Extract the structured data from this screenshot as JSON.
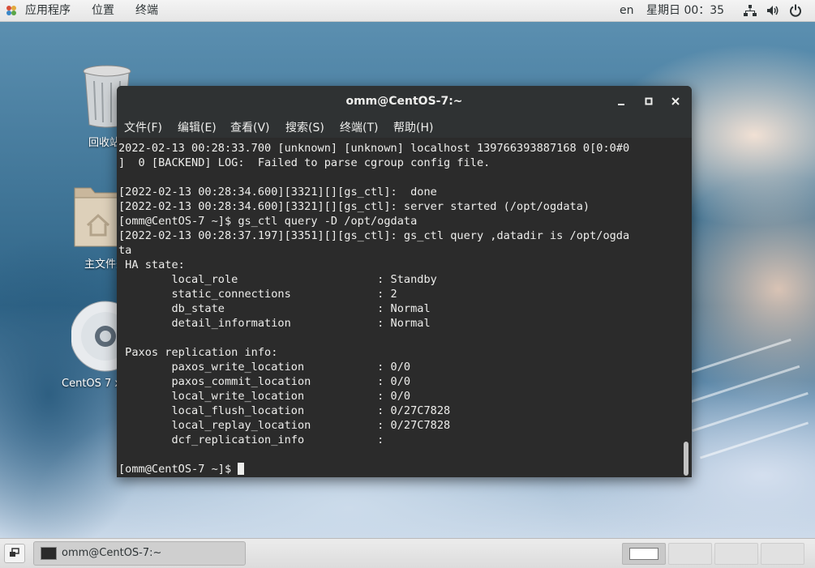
{
  "top_panel": {
    "menus": [
      "应用程序",
      "位置",
      "终端"
    ],
    "lang": "en",
    "clock": "星期日 00：35"
  },
  "desktop": {
    "icons": [
      {
        "name": "trash",
        "label": "回收站"
      },
      {
        "name": "home",
        "label": "主文件夹"
      },
      {
        "name": "dvd",
        "label": "CentOS 7 x86_64"
      }
    ]
  },
  "terminal": {
    "title": "omm@CentOS-7:~",
    "menu": [
      "文件(F)",
      "编辑(E)",
      "查看(V)",
      "搜索(S)",
      "终端(T)",
      "帮助(H)"
    ],
    "lines": [
      "2022-02-13 00:28:33.700 [unknown] [unknown] localhost 139766393887168 0[0:0#0",
      "]  0 [BACKEND] LOG:  Failed to parse cgroup config file.",
      "",
      "[2022-02-13 00:28:34.600][3321][][gs_ctl]:  done",
      "[2022-02-13 00:28:34.600][3321][][gs_ctl]: server started (/opt/ogdata)",
      "[omm@CentOS-7 ~]$ gs_ctl query -D /opt/ogdata",
      "[2022-02-13 00:28:37.197][3351][][gs_ctl]: gs_ctl query ,datadir is /opt/ogda",
      "ta",
      " HA state:",
      "        local_role                     : Standby",
      "        static_connections             : 2",
      "        db_state                       : Normal",
      "        detail_information             : Normal",
      "",
      " Paxos replication info:",
      "        paxos_write_location           : 0/0",
      "        paxos_commit_location          : 0/0",
      "        local_write_location           : 0/0",
      "        local_flush_location           : 0/27C7828",
      "        local_replay_location          : 0/27C7828",
      "        dcf_replication_info           :",
      "",
      "[omm@CentOS-7 ~]$ "
    ]
  },
  "taskbar": {
    "task_label": "omm@CentOS-7:~",
    "workspaces": [
      true,
      false,
      false,
      false
    ]
  },
  "colors": {
    "terminal_bg": "#2b2b2b",
    "terminal_fg": "#eeeeec",
    "titlebar_bg": "#2f3233"
  }
}
